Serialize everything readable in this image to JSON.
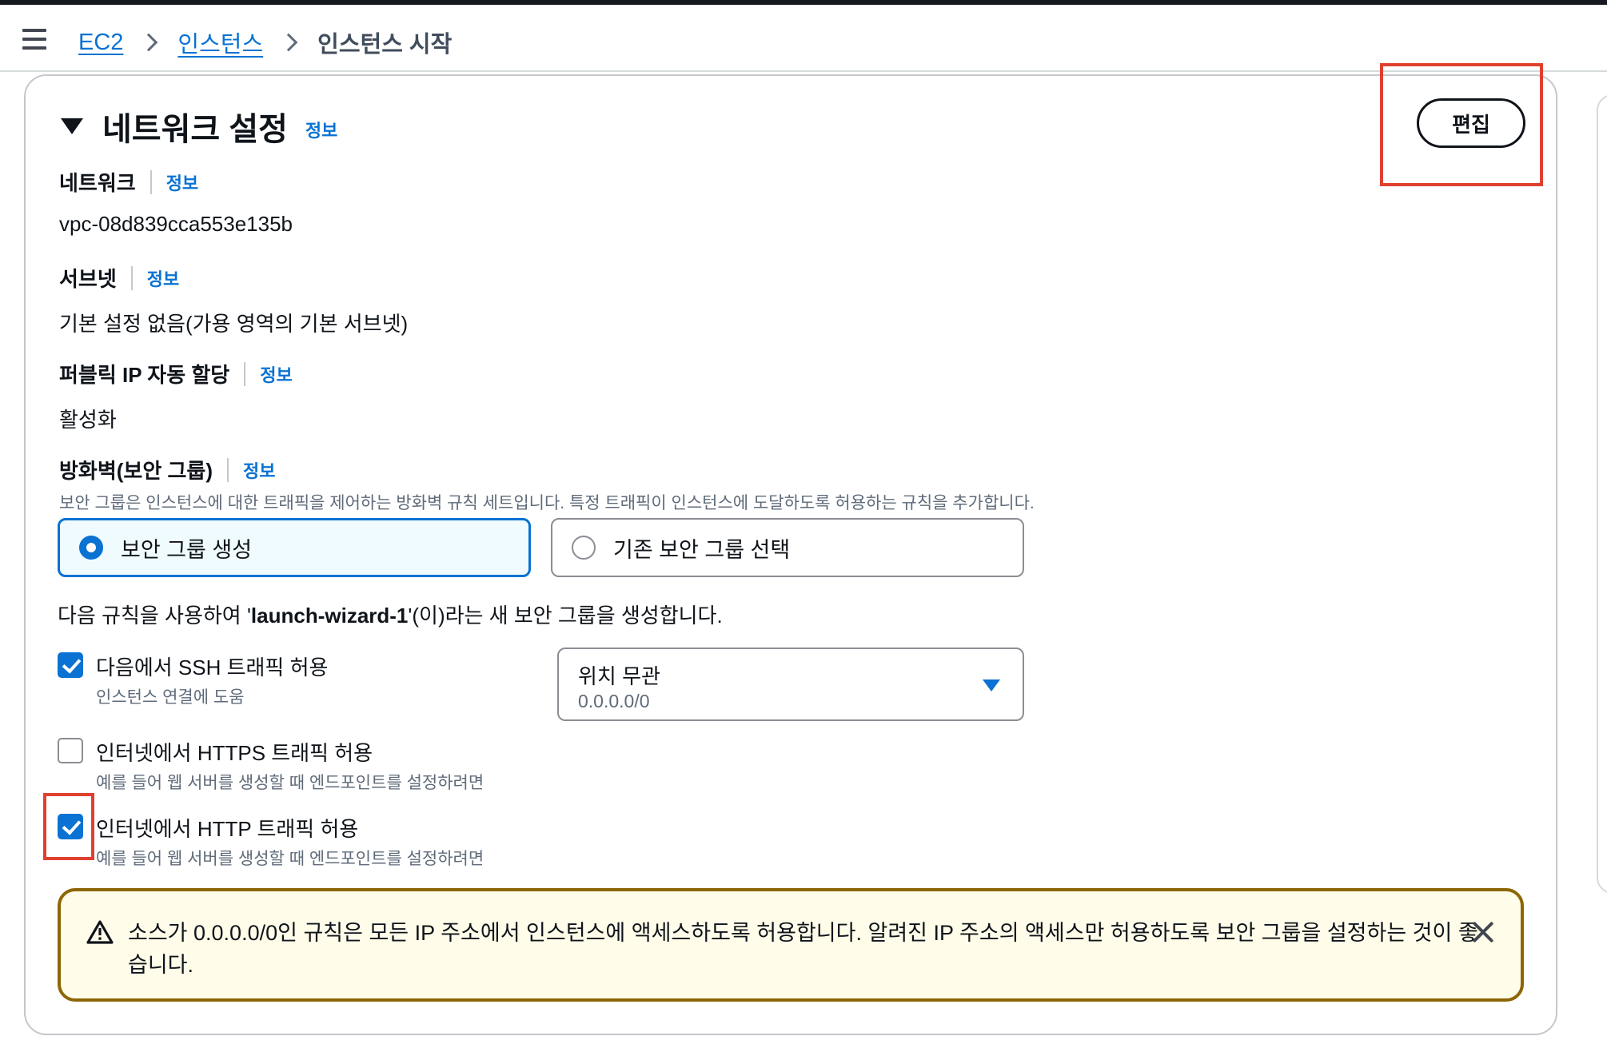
{
  "breadcrumb": {
    "items": [
      "EC2",
      "인스턴스"
    ],
    "current": "인스턴스 시작"
  },
  "section": {
    "title": "네트워크 설정",
    "info": "정보",
    "edit_label": "편집"
  },
  "network": {
    "label": "네트워크",
    "info": "정보",
    "value": "vpc-08d839cca553e135b"
  },
  "subnet": {
    "label": "서브넷",
    "info": "정보",
    "value": "기본 설정 없음(가용 영역의 기본 서브넷)"
  },
  "public_ip": {
    "label": "퍼블릭 IP 자동 할당",
    "info": "정보",
    "value": "활성화"
  },
  "firewall": {
    "label": "방화벽(보안 그룹)",
    "info": "정보",
    "description": "보안 그룹은 인스턴스에 대한 트래픽을 제어하는 방화벽 규칙 세트입니다. 특정 트래픽이 인스턴스에 도달하도록 허용하는 규칙을 추가합니다.",
    "options": [
      {
        "label": "보안 그룹 생성",
        "selected": true
      },
      {
        "label": "기존 보안 그룹 선택",
        "selected": false
      }
    ],
    "rule_text_prefix": "다음 규칙을 사용하여 '",
    "rule_group_name": "launch-wizard-1",
    "rule_text_suffix": "'(이)라는 새 보안 그룹을 생성합니다."
  },
  "rules": [
    {
      "label": "다음에서 SSH 트래픽 허용",
      "description": "인스턴스 연결에 도움",
      "checked": true
    },
    {
      "label": "인터넷에서 HTTPS 트래픽 허용",
      "description": "예를 들어 웹 서버를 생성할 때 엔드포인트를 설정하려면",
      "checked": false
    },
    {
      "label": "인터넷에서 HTTP 트래픽 허용",
      "description": "예를 들어 웹 서버를 생성할 때 엔드포인트를 설정하려면",
      "checked": true
    }
  ],
  "ssh_source": {
    "value": "위치 무관",
    "sub": "0.0.0.0/0"
  },
  "warning": {
    "text": "소스가 0.0.0.0/0인 규칙은 모든 IP 주소에서 인스턴스에 액세스하도록 허용합니다. 알려진 IP 주소의 액세스만 허용하도록 보안 그룹을 설정하는 것이 좋습니다."
  },
  "colors": {
    "link": "#0972d3",
    "highlight": "#e0412f",
    "warning_border": "#8d6605",
    "warning_bg": "#fffce9"
  }
}
